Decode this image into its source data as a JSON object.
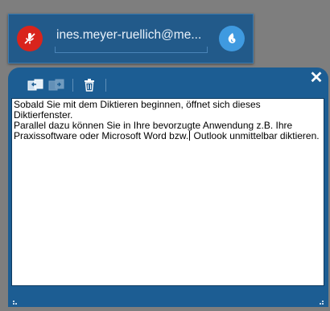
{
  "dictation_bar": {
    "user": "ines.meyer-ruellich@me...",
    "mic_icon": "microphone-off-icon",
    "dragon_icon": "dragon-flame-icon",
    "colors": {
      "bar": "#225a8a",
      "mic": "#d9241c",
      "dragon": "#3f9ae0"
    }
  },
  "dictation_box": {
    "toolbar": {
      "transfer_icon": "transfer-text-icon",
      "transfer_disabled_icon": "transfer-text-disabled-icon",
      "delete_icon": "trash-icon"
    },
    "close_label": "✕",
    "text": {
      "line1": "Sobald Sie mit dem Diktieren beginnen, öffnet sich dieses Diktierfenster.",
      "line2_before_caret": "Parallel dazu können Sie in Ihre bevorzugte Anwendung z.B. Ihre Praxissoftware oder Microsoft Word bzw.",
      "line2_after_caret": " Outlook unmittelbar diktieren."
    }
  }
}
